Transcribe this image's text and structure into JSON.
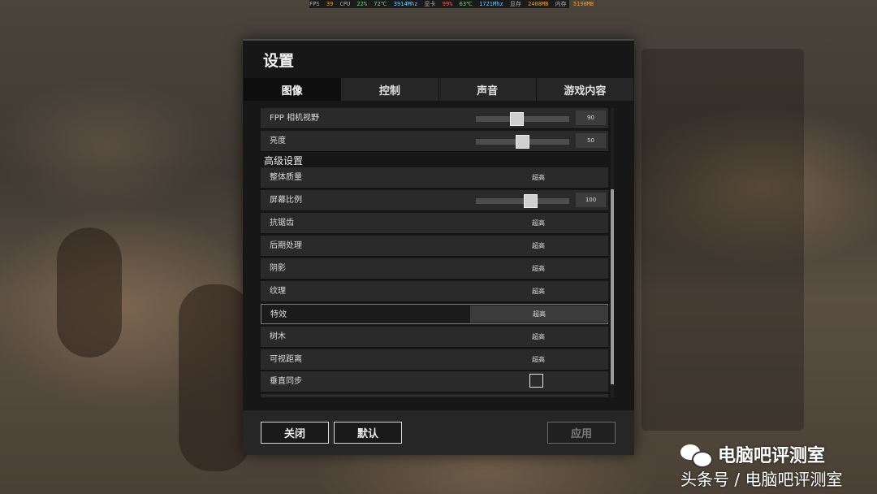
{
  "perf_overlay": [
    {
      "text": "FPS",
      "color": "lbl"
    },
    {
      "text": "39",
      "color": "org"
    },
    {
      "text": "CPU",
      "color": "lbl"
    },
    {
      "text": "22%",
      "color": "grn"
    },
    {
      "text": "72℃",
      "color": "grn"
    },
    {
      "text": "3914Mhz",
      "color": "cyn"
    },
    {
      "text": "显卡",
      "color": "lbl"
    },
    {
      "text": "99%",
      "color": "red"
    },
    {
      "text": "63℃",
      "color": "grn"
    },
    {
      "text": "1721Mhz",
      "color": "cyn"
    },
    {
      "text": "显存",
      "color": "lbl"
    },
    {
      "text": "2408MB",
      "color": "org"
    },
    {
      "text": "内存",
      "color": "lbl"
    },
    {
      "text": "5190MB",
      "color": "org"
    }
  ],
  "dialog": {
    "title": "设置",
    "tabs": [
      {
        "label": "图像",
        "active": true
      },
      {
        "label": "控制",
        "active": false
      },
      {
        "label": "声音",
        "active": false
      },
      {
        "label": "游戏内容",
        "active": false
      }
    ],
    "sliders": {
      "fpp_fov": {
        "label": "FPP 相机视野",
        "value": "90",
        "fraction": 0.43
      },
      "brightness": {
        "label": "亮度",
        "value": "50",
        "fraction": 0.5
      },
      "screen_scale": {
        "label": "屏幕比例",
        "value": "100",
        "fraction": 0.6
      }
    },
    "section_advanced": "高级设置",
    "options": {
      "overall_quality": {
        "label": "整体质量",
        "value": "超高"
      },
      "anti_aliasing": {
        "label": "抗锯齿",
        "value": "超高"
      },
      "post_processing": {
        "label": "后期处理",
        "value": "超高"
      },
      "shadows": {
        "label": "阴影",
        "value": "超高"
      },
      "textures": {
        "label": "纹理",
        "value": "超高"
      },
      "effects": {
        "label": "特效",
        "value": "超高"
      },
      "foliage": {
        "label": "树木",
        "value": "超高"
      },
      "view_distance": {
        "label": "可视距离",
        "value": "超高"
      }
    },
    "vsync": {
      "label": "垂直同步",
      "checked": false
    },
    "buttons": {
      "close": "关闭",
      "default": "默认",
      "apply": "应用"
    }
  },
  "watermark": {
    "line1": "电脑吧评测室",
    "line2": "头条号 / 电脑吧评测室"
  }
}
